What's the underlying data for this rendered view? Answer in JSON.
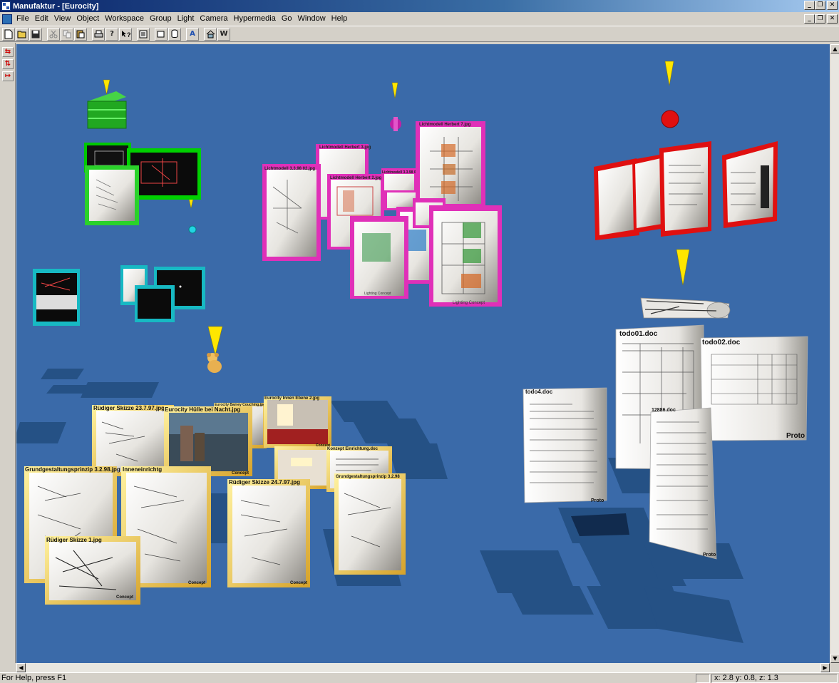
{
  "window": {
    "title": "Manufaktur - [Eurocity]"
  },
  "menu": [
    "File",
    "Edit",
    "View",
    "Object",
    "Workspace",
    "Group",
    "Light",
    "Camera",
    "Hypermedia",
    "Go",
    "Window",
    "Help"
  ],
  "caption_buttons": {
    "minimize": "_",
    "restore": "❐",
    "close": "✕"
  },
  "toolbar_icons": [
    "new-icon",
    "open-icon",
    "save-icon",
    "cut-icon",
    "copy-icon",
    "paste-icon",
    "print-icon",
    "help-icon",
    "context-help-icon",
    "doc-icon",
    "box-icon",
    "cylinder-icon",
    "text-icon",
    "house-icon",
    "w-icon"
  ],
  "toolbar_labels": {
    "text": "A",
    "w": "W"
  },
  "scene": {
    "cards": [
      {
        "label": "Rüdiger Skizze 23.7.97.jpg",
        "tag": "Concept"
      },
      {
        "label": "Eurocity Hülle bei Nacht.jpg",
        "tag": "Concept"
      },
      {
        "label": "Eurocity Innen Ebene 2.jpg",
        "tag": "Concept"
      },
      {
        "label": "Konzept Einrichtung.doc",
        "tag": "Concept"
      },
      {
        "label": "Grundgestaltungsprinzip 3.2.98.jpg",
        "tag": "Concept"
      },
      {
        "label": "Inneneinrichtg",
        "tag": "Concept"
      },
      {
        "label": "Rüdiger Skizze 24.7.97.jpg",
        "tag": "Concept"
      },
      {
        "label": "Grundgestaltungsprinzip 3.2.98",
        "tag": "Concept"
      },
      {
        "label": "Rüdiger Skizze 1.jpg",
        "tag": "Concept"
      },
      {
        "label": "Eurocity Bamey Couching.jpg",
        "tag": ""
      },
      {
        "label": "todo01.doc",
        "tag": ""
      },
      {
        "label": "todo02.doc",
        "tag": "Proto"
      },
      {
        "label": "todo4.doc",
        "tag": "Proto"
      },
      {
        "label": "12886.doc",
        "tag": "Proto"
      },
      {
        "label": "Lichtmodell Herbert 7.jpg",
        "tag": ""
      },
      {
        "label": "Lichtmodell Herbert 3.jpg",
        "tag": ""
      },
      {
        "label": "Lichtmodell 3.3.98 02.jpg",
        "tag": "Lighting Concept"
      },
      {
        "label": "Lichtmodell 3.3.98 01.jpg",
        "tag": ""
      },
      {
        "label": "Lichtmodell Herbert 2.jpg",
        "tag": ""
      },
      {
        "label": "Lichtmodell Herbert 1.jpg",
        "tag": "Lighting Concept"
      },
      {
        "label": "Lighting Concept",
        "tag": "Lighting Concept"
      }
    ]
  },
  "status": {
    "help": "For Help, press F1",
    "coords": "x: 2.8 y: 0.8, z: 1.3"
  }
}
